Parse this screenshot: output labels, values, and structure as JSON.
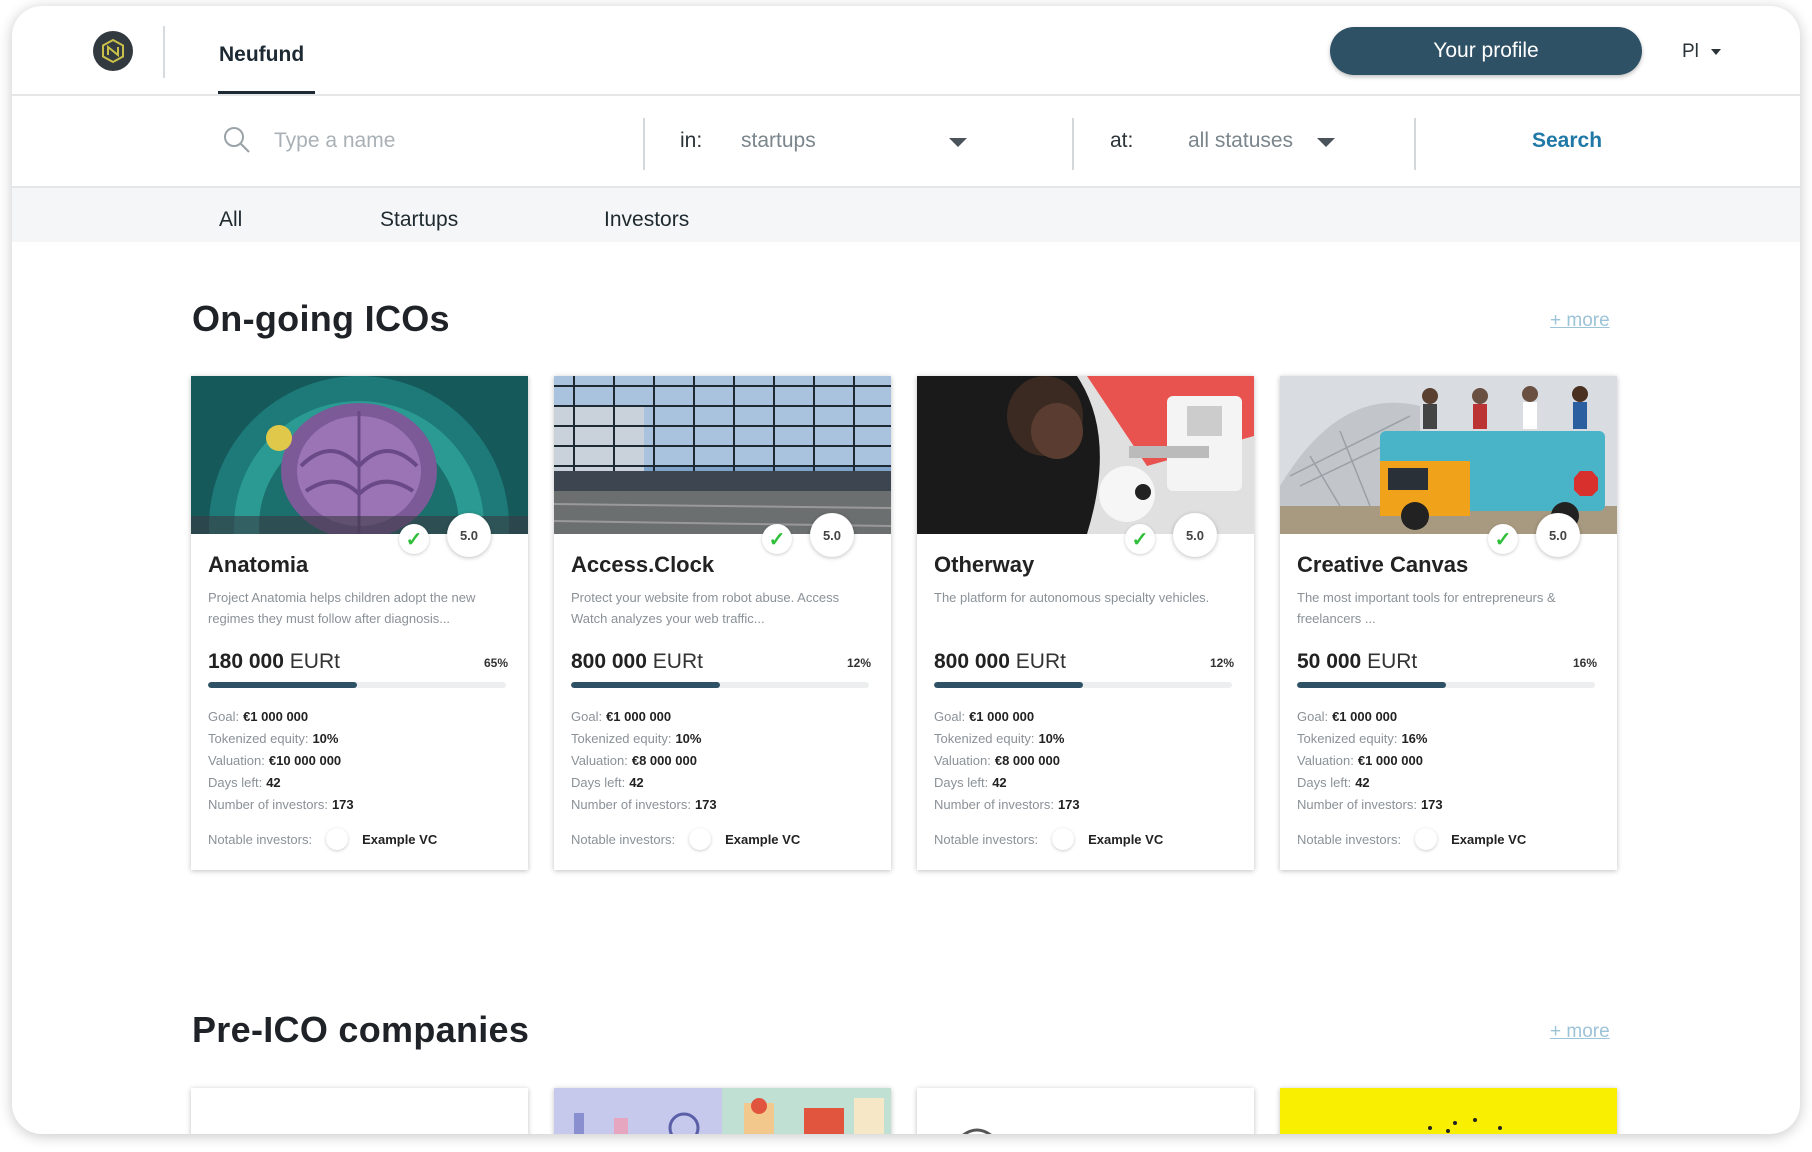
{
  "header": {
    "brand_tab": "Neufund",
    "profile_button": "Your profile",
    "language": "Pl",
    "logo_icon": "neufund-logo-icon"
  },
  "search": {
    "placeholder": "Type a name",
    "in_label": "in:",
    "in_value": "startups",
    "at_label": "at:",
    "at_value": "all statuses",
    "button": "Search"
  },
  "filters": [
    "All",
    "Startups",
    "Investors"
  ],
  "sections": {
    "ongoing": {
      "title": "On-going ICOs",
      "more": "+ more"
    },
    "preico": {
      "title": "Pre-ICO companies",
      "more": "+ more"
    }
  },
  "labels": {
    "goal": "Goal:",
    "equity": "Tokenized equity:",
    "valuation": "Valuation:",
    "days": "Days left:",
    "investors": "Number of investors:",
    "notable": "Notable investors:",
    "currency": "EURt"
  },
  "cards": [
    {
      "name": "Anatomia",
      "desc": "Project Anatomia helps children adopt the new regimes they must follow after diagnosis...",
      "amount": "180 000",
      "percent": "65%",
      "progress": 0.5,
      "rating": "5.0",
      "goal": "€1 000 000",
      "equity": "10%",
      "valuation": "€10 000 000",
      "days": "42",
      "investors": "173",
      "notable": "Example VC"
    },
    {
      "name": "Access.Clock",
      "desc": "Protect your website from robot abuse. Access Watch analyzes your web traffic...",
      "amount": "800 000",
      "percent": "12%",
      "progress": 0.5,
      "rating": "5.0",
      "goal": "€1 000 000",
      "equity": "10%",
      "valuation": "€8 000 000",
      "days": "42",
      "investors": "173",
      "notable": "Example VC"
    },
    {
      "name": "Otherway",
      "desc": "The platform for autonomous specialty vehicles.",
      "amount": "800 000",
      "percent": "12%",
      "progress": 0.5,
      "rating": "5.0",
      "goal": "€1 000 000",
      "equity": "10%",
      "valuation": "€8 000 000",
      "days": "42",
      "investors": "173",
      "notable": "Example VC"
    },
    {
      "name": "Creative Canvas",
      "desc": "The most important tools for entrepreneurs & freelancers ...",
      "amount": "50 000",
      "percent": "16%",
      "progress": 0.5,
      "rating": "5.0",
      "goal": "€1 000 000",
      "equity": "16%",
      "valuation": "€1 000 000",
      "days": "42",
      "investors": "173",
      "notable": "Example VC"
    }
  ],
  "colors": {
    "primary": "#2f5165",
    "link": "#1f78a6",
    "check": "#2fbf3a"
  }
}
